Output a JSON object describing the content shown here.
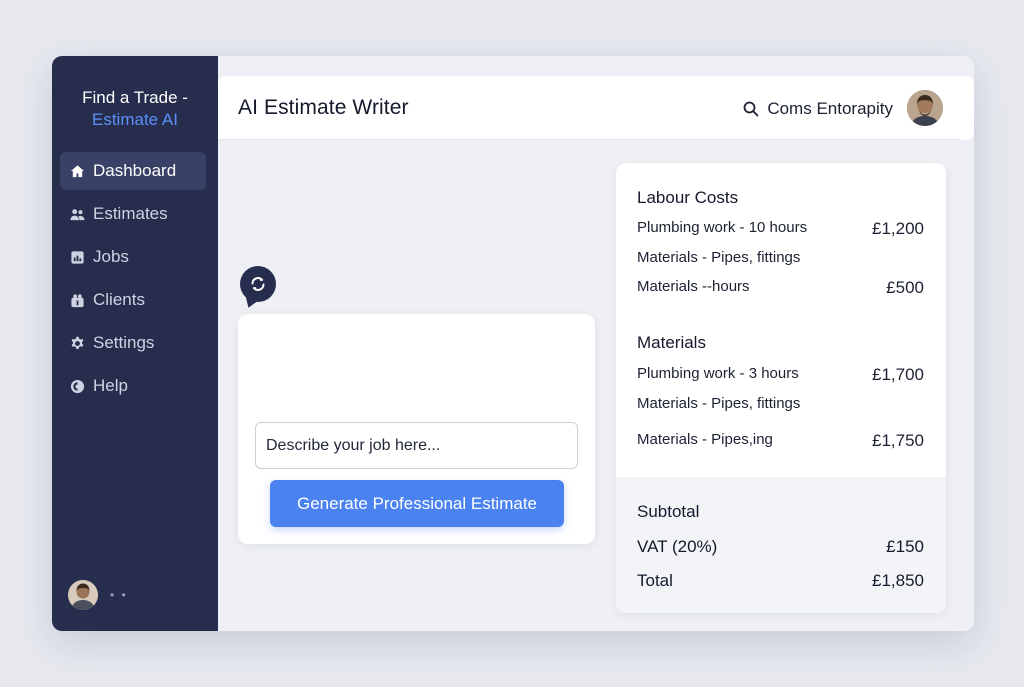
{
  "sidebar": {
    "brand_line1": "Find a Trade -",
    "brand_line2": "Estimate AI",
    "items": [
      {
        "label": "Dashboard",
        "icon": "home-icon",
        "active": true
      },
      {
        "label": "Estimates",
        "icon": "users-icon",
        "active": false
      },
      {
        "label": "Jobs",
        "icon": "briefcase-icon",
        "active": false
      },
      {
        "label": "Clients",
        "icon": "client-icon",
        "active": false
      },
      {
        "label": "Settings",
        "icon": "gear-icon",
        "active": false
      },
      {
        "label": "Help",
        "icon": "help-icon",
        "active": false
      }
    ],
    "footer_dots": "• •"
  },
  "header": {
    "title": "AI Estimate Writer",
    "account_name": "Coms Entorapity"
  },
  "compose": {
    "placeholder": "Describe your job here...",
    "generate_label": "Generate Professional Estimate"
  },
  "estimate": {
    "sections": [
      {
        "title": "Labour Costs",
        "lines": [
          {
            "desc": "Plumbing work - 10 hours",
            "amount": "£1,200"
          },
          {
            "desc": "Materials - Pipes, fittings",
            "amount": ""
          },
          {
            "desc": "Materials --hours",
            "amount": "£500"
          }
        ]
      },
      {
        "title": "Materials",
        "lines": [
          {
            "desc": "Plumbing work - 3 hours",
            "amount": "£1,700"
          },
          {
            "desc": "Materials - Pipes, fittings",
            "amount": ""
          },
          {
            "desc": "Materials - Pipes,ing",
            "amount": "£1,750"
          }
        ]
      }
    ],
    "subtotal_label": "Subtotal",
    "subtotal_amount": "",
    "vat_label": "VAT (20%)",
    "vat_amount": "£150",
    "total_label": "Total",
    "total_amount": "£1,850"
  },
  "colors": {
    "sidebar_bg": "#272d4d",
    "accent": "#4a82f0",
    "brand_accent": "#5b8ff9"
  }
}
